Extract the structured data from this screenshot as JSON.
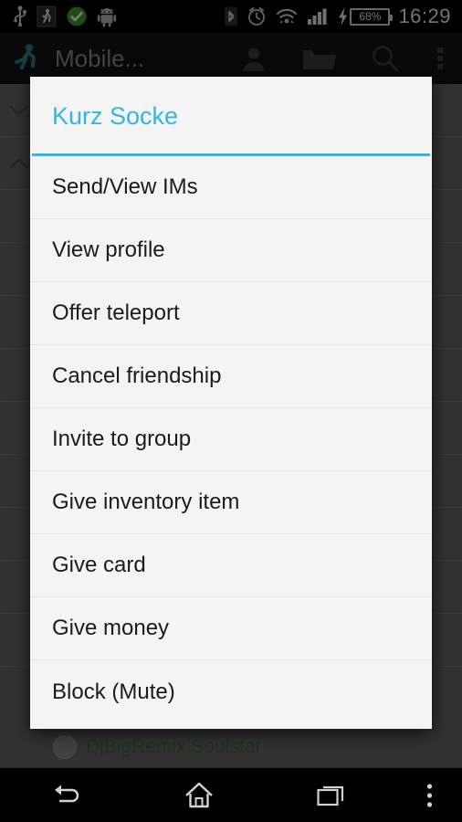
{
  "statusbar": {
    "icons_left": [
      "usb-icon",
      "walking-person-icon",
      "check-circle-icon",
      "android-robot-icon"
    ],
    "icons_right": [
      "bluetooth-icon",
      "alarm-clock-icon",
      "wifi-icon",
      "cellular-signal-icon",
      "charging-bolt-icon"
    ],
    "battery_percent": "68%",
    "clock": "16:29"
  },
  "actionbar": {
    "logo": "walking-person-logo",
    "title": "Mobile...",
    "actions": [
      {
        "name": "people-icon",
        "label": "People"
      },
      {
        "name": "folder-icon",
        "label": "Inventory"
      },
      {
        "name": "search-icon",
        "label": "Search"
      },
      {
        "name": "overflow-menu-icon",
        "label": "More options"
      }
    ]
  },
  "background": {
    "collapse_chevron": "chevron-down-icon",
    "expand_chevron": "chevron-up-icon",
    "list_item": {
      "avatar": "avatar-circle",
      "name": "DjBigRemix Soulstar",
      "name_color": "#3c6b3c"
    }
  },
  "dialog": {
    "title": "Kurz Socke",
    "title_color": "#33b5e5",
    "accent_color": "#33b5e5",
    "background_color": "#f4f4f4",
    "items": [
      {
        "label": "Send/View IMs"
      },
      {
        "label": "View profile"
      },
      {
        "label": "Offer teleport"
      },
      {
        "label": "Cancel friendship"
      },
      {
        "label": "Invite to group"
      },
      {
        "label": "Give inventory item"
      },
      {
        "label": "Give card"
      },
      {
        "label": "Give money"
      },
      {
        "label": "Block (Mute)"
      }
    ]
  },
  "navbar": {
    "buttons": [
      {
        "name": "back-icon",
        "label": "Back"
      },
      {
        "name": "home-icon",
        "label": "Home"
      },
      {
        "name": "recents-icon",
        "label": "Recent apps"
      },
      {
        "name": "overflow-menu-icon",
        "label": "Menu"
      }
    ]
  }
}
